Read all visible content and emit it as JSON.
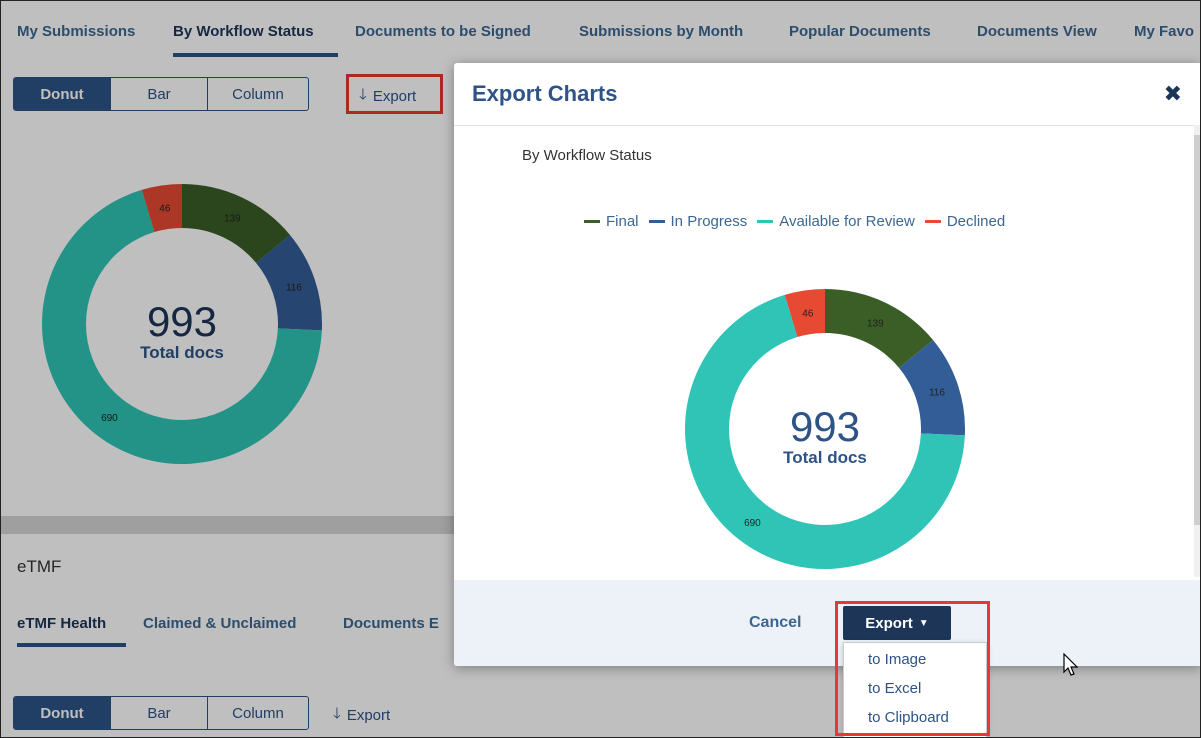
{
  "top_tabs": [
    "My Submissions",
    "By Workflow Status",
    "Documents to be Signed",
    "Submissions by Month",
    "Popular Documents",
    "Documents View",
    "My Favo"
  ],
  "chart_view_toggle": [
    "Donut",
    "Bar",
    "Column"
  ],
  "export_label": "Export",
  "etmf": {
    "title": "eTMF",
    "tabs": [
      "eTMF Health",
      "Claimed & Unclaimed",
      "Documents E"
    ],
    "toggle": [
      "Donut",
      "Bar",
      "Column"
    ],
    "export_label": "Export"
  },
  "modal": {
    "title": "Export Charts",
    "chart_title": "By Workflow Status",
    "cancel_label": "Cancel",
    "export_button_label": "Export",
    "dropdown": [
      "to Image",
      "to Excel",
      "to Clipboard"
    ]
  },
  "chart_data": {
    "type": "pie",
    "title": "By Workflow Status",
    "series": [
      {
        "name": "Final",
        "value": 139,
        "color": "#3a5e26"
      },
      {
        "name": "In Progress",
        "value": 116,
        "color": "#335d96"
      },
      {
        "name": "Available for Review",
        "value": 690,
        "color": "#2fc4b6"
      },
      {
        "name": "Declined",
        "value": 46,
        "color": "#e64a33"
      }
    ],
    "center_value": "993",
    "center_label": "Total docs",
    "legend_placement": "top"
  },
  "colors": {
    "accent": "#2d5387",
    "highlight_box": "#e53935"
  }
}
